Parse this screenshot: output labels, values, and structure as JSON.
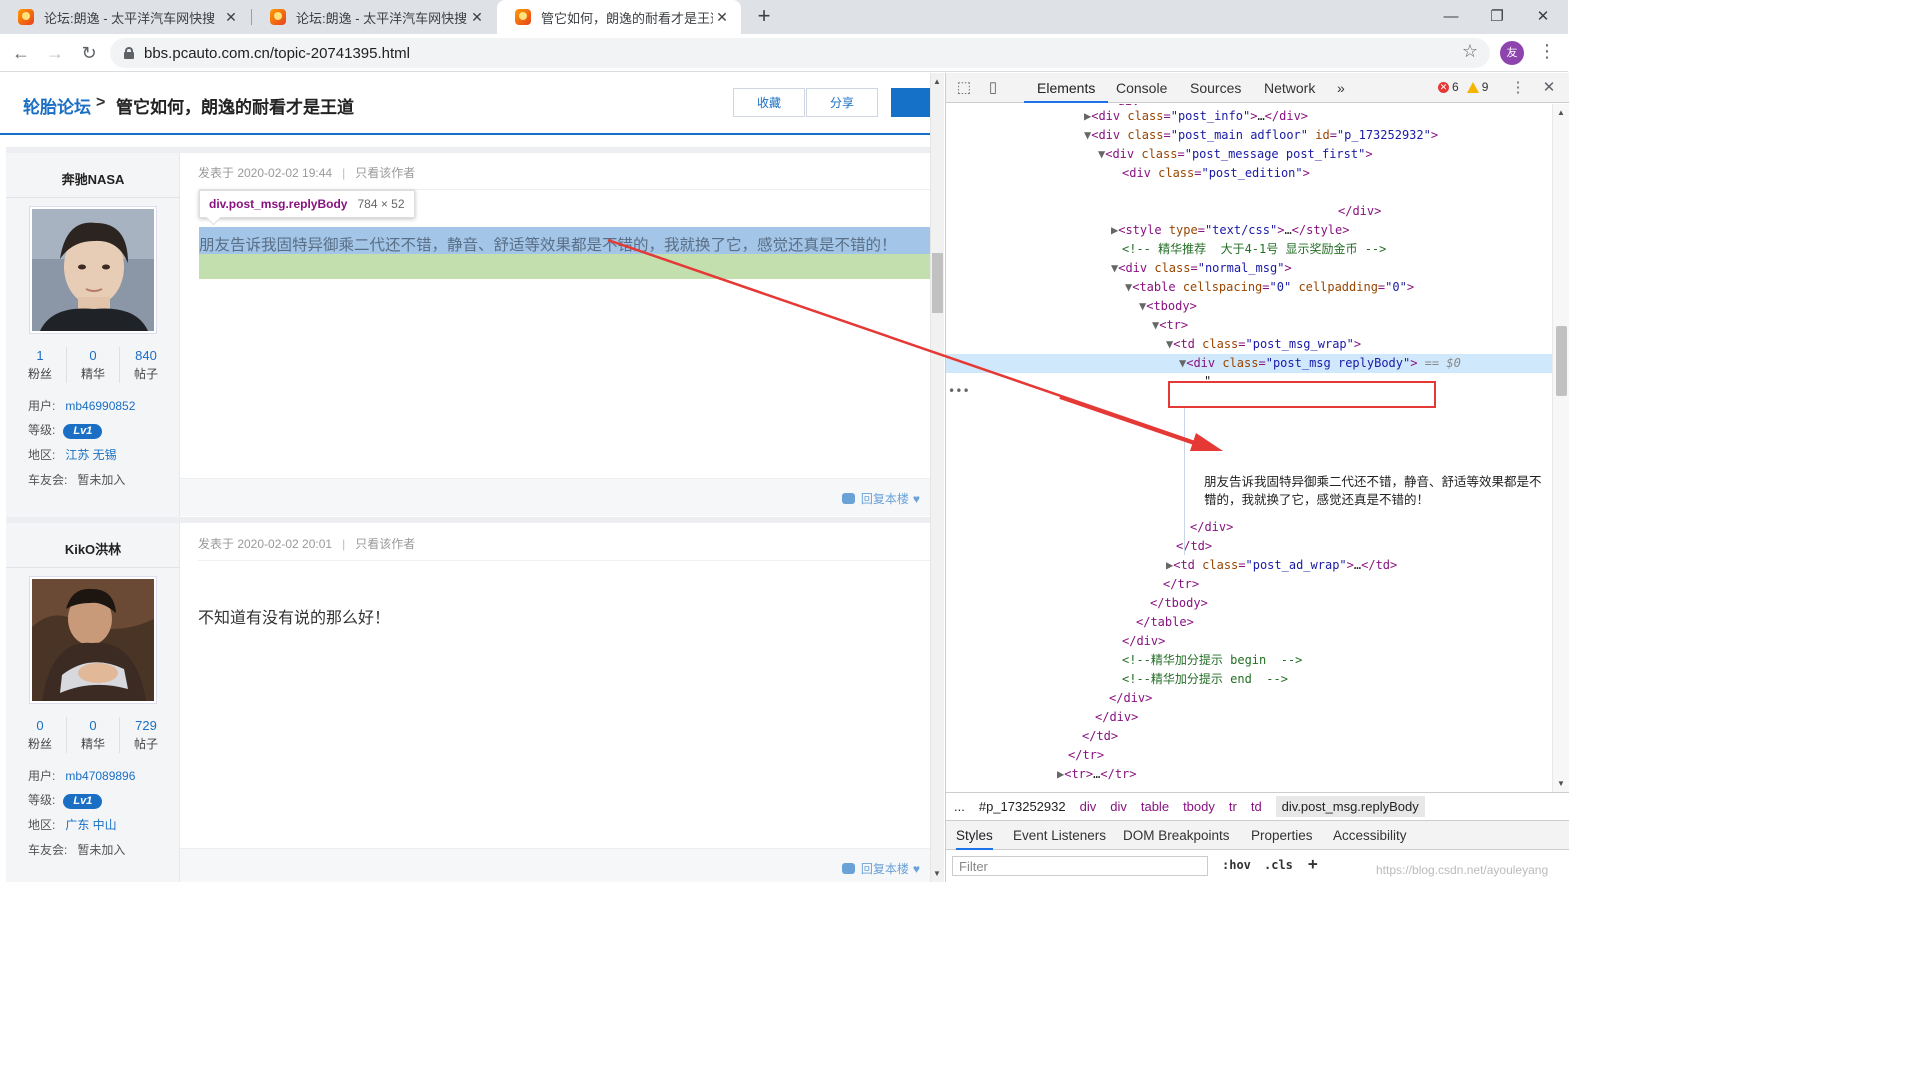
{
  "browser": {
    "tabs": [
      {
        "title": "论坛:朗逸 - 太平洋汽车网快搜"
      },
      {
        "title": "论坛:朗逸 - 太平洋汽车网快搜"
      },
      {
        "title": "管它如何，朗逸的耐看才是王道_"
      }
    ],
    "url": "bbs.pcauto.com.cn/topic-20741395.html",
    "profile_initial": "友"
  },
  "page": {
    "breadcrumb_link": "轮胎论坛",
    "breadcrumb_sep": ">",
    "title": "管它如何，朗逸的耐看才是王道",
    "favorite_label": "收藏",
    "share_label": "分享",
    "posts": [
      {
        "author": "奔驰NASA",
        "fans": "1",
        "fans_label": "粉丝",
        "essence": "0",
        "essence_label": "精华",
        "posts": "840",
        "posts_label": "帖子",
        "user_label": "用户:",
        "user_id": "mb46990852",
        "level_label": "等级:",
        "level": "Lv1",
        "region_label": "地区:",
        "region": "江苏 无锡",
        "club_label": "车友会:",
        "club": "暂未加入",
        "posted_at": "发表于 2020-02-02 19:44",
        "only_author": "只看该作者",
        "content": "朋友告诉我固特异御乘二代还不错，静音、舒适等效果都是不错的，我就换了它，感觉还真是不错的！",
        "reply_label": "回复本楼"
      },
      {
        "author": "KikO洪林",
        "fans": "0",
        "fans_label": "粉丝",
        "essence": "0",
        "essence_label": "精华",
        "posts": "729",
        "posts_label": "帖子",
        "user_label": "用户:",
        "user_id": "mb47089896",
        "level_label": "等级:",
        "level": "Lv1",
        "region_label": "地区:",
        "region": "广东 中山",
        "club_label": "车友会:",
        "club": "暂未加入",
        "posted_at": "发表于 2020-02-02 20:01",
        "only_author": "只看该作者",
        "content": "不知道有没有说的那么好！",
        "reply_label": "回复本楼"
      }
    ],
    "inspect_tooltip": {
      "selector": "div.post_msg.replyBody",
      "size": "784 × 52"
    }
  },
  "devtools": {
    "tabs": [
      "Elements",
      "Console",
      "Sources",
      "Network",
      "»"
    ],
    "errors": "6",
    "warnings": "9",
    "text_node": "朋友告诉我固特异御乘二代还不错，静音、舒适等效果都是不错的，我就换了它，感觉还真是不错的！",
    "breadcrumbs": [
      "...",
      "#p_173252932",
      "div",
      "div",
      "table",
      "tbody",
      "tr",
      "td",
      "div.post_msg.replyBody"
    ],
    "subtabs": [
      "Styles",
      "Event Listeners",
      "DOM Breakpoints",
      "Properties",
      "Accessibility"
    ],
    "filter_placeholder": "Filter",
    "hov": ":hov",
    "cls": ".cls",
    "plus": "+",
    "watermark": "https://blog.csdn.net/ayouleyang"
  },
  "colors": {
    "accent": "#1570c8",
    "highlight_blue": "#a3c5e8",
    "highlight_green": "#c4dfae",
    "arrow": "#e53935"
  }
}
